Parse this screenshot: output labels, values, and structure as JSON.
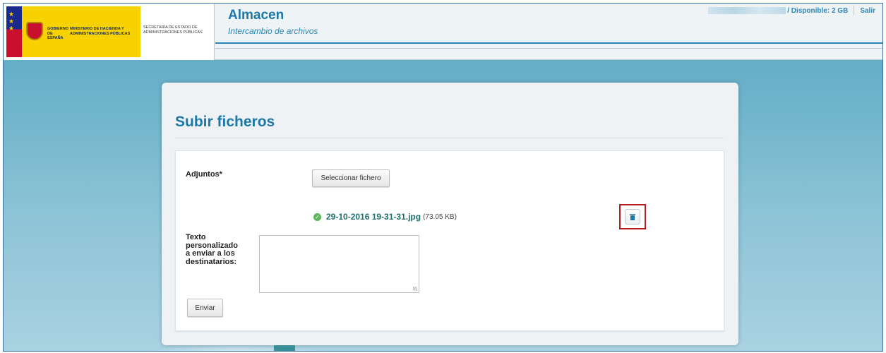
{
  "header": {
    "logo_government": "GOBIERNO DE ESPAÑA",
    "logo_ministry": "MINISTERIO DE HACIENDA Y ADMINISTRACIONES PÚBLICAS",
    "logo_secretariat": "SECRETARÍA DE ESTADO DE ADMINISTRACIONES PÚBLICAS",
    "app_title": "Almacen",
    "app_subtitle": "Intercambio de archivos",
    "available": "/ Disponible: 2 GB",
    "logout": "Salir"
  },
  "upload": {
    "title": "Subir ficheros",
    "attachments_label": "Adjuntos*",
    "select_file_label": "Seleccionar fichero",
    "file": {
      "name": "29-10-2016 19-31-31.jpg",
      "size": "(73.05 KB)",
      "status_icon": "check-circle-icon",
      "delete_icon": "trash-icon"
    },
    "message_label": "Texto personalizado a enviar a los destinatarios:",
    "message_value": "",
    "send_label": "Enviar"
  },
  "colors": {
    "accent": "#1d78a8",
    "highlight_border": "#b21e23",
    "success": "#5cb85c"
  }
}
